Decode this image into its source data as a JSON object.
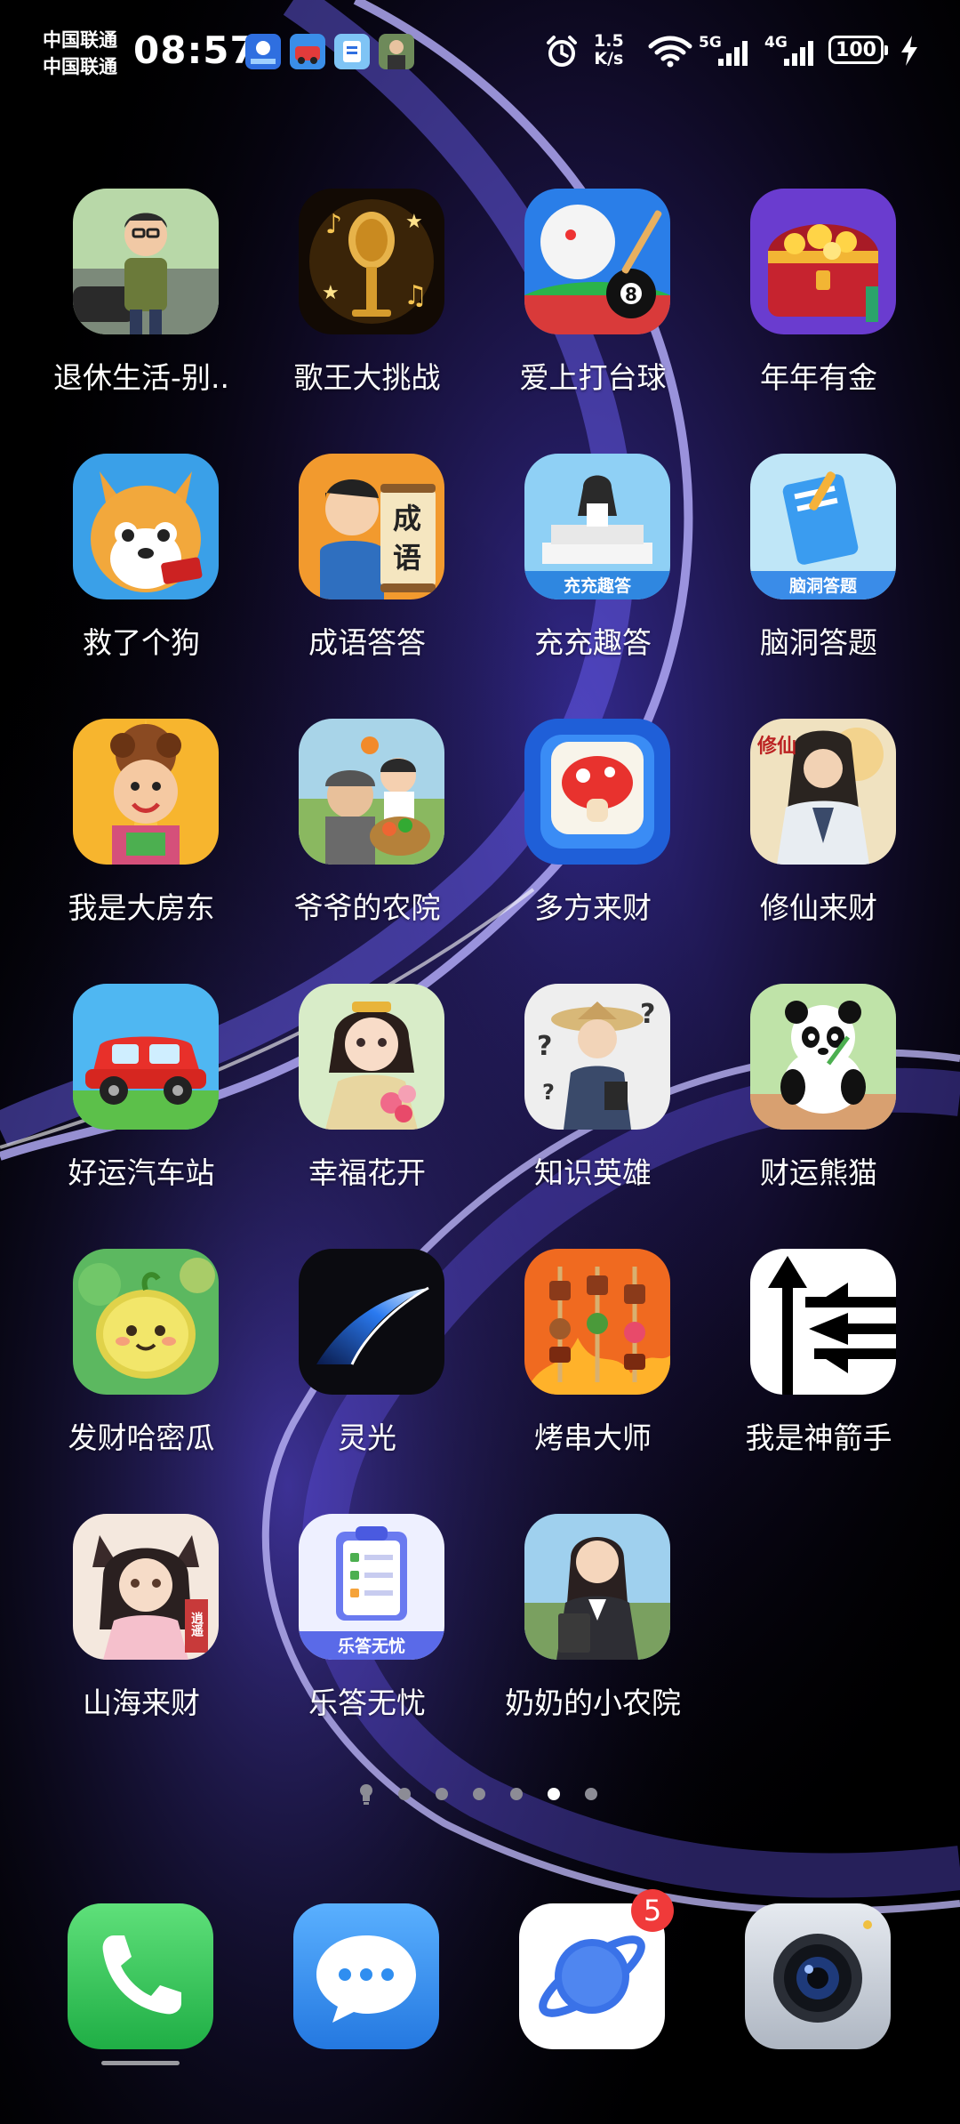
{
  "status_bar": {
    "carrier_1": "中国联通",
    "carrier_2": "中国联通",
    "time": "08:57",
    "net_speed_value": "1.5",
    "net_speed_unit": "K/s",
    "sim1_network": "5G",
    "sim2_network": "4G",
    "battery_level": "100",
    "icons": [
      "alarm-icon",
      "wifi-icon",
      "signal-icon",
      "charging-icon"
    ]
  },
  "apps": [
    {
      "label": "退休生活-别..",
      "icon": "retired-man-icon"
    },
    {
      "label": "歌王大挑战",
      "icon": "microphone-icon"
    },
    {
      "label": "爱上打台球",
      "icon": "billiards-icon"
    },
    {
      "label": "年年有金",
      "icon": "treasure-chest-icon"
    },
    {
      "label": "救了个狗",
      "icon": "dog-icon"
    },
    {
      "label": "成语答答",
      "icon": "idiom-scholar-icon",
      "icon_text": [
        "成",
        "语"
      ]
    },
    {
      "label": "充充趣答",
      "icon": "book-girl-icon",
      "icon_text": "充充趣答"
    },
    {
      "label": "脑洞答题",
      "icon": "blue-book-icon",
      "icon_text": "脑洞答题"
    },
    {
      "label": "我是大房东",
      "icon": "landlady-icon"
    },
    {
      "label": "爷爷的农院",
      "icon": "grandpa-farm-icon"
    },
    {
      "label": "多方来财",
      "icon": "mushroom-tile-icon"
    },
    {
      "label": "修仙来财",
      "icon": "cultivator-icon",
      "icon_text": "修仙"
    },
    {
      "label": "好运汽车站",
      "icon": "red-car-icon"
    },
    {
      "label": "幸福花开",
      "icon": "flower-lady-icon"
    },
    {
      "label": "知识英雄",
      "icon": "scholar-question-icon"
    },
    {
      "label": "财运熊猫",
      "icon": "panda-icon"
    },
    {
      "label": "发财哈密瓜",
      "icon": "melon-icon"
    },
    {
      "label": "灵光",
      "icon": "lingguang-icon"
    },
    {
      "label": "烤串大师",
      "icon": "skewer-icon"
    },
    {
      "label": "我是神箭手",
      "icon": "arrows-icon"
    },
    {
      "label": "山海来财",
      "icon": "fox-girl-icon",
      "icon_text": "逍遥"
    },
    {
      "label": "乐答无忧",
      "icon": "clipboard-icon",
      "icon_text": "乐答无忧"
    },
    {
      "label": "奶奶的小农院",
      "icon": "businesswoman-icon"
    }
  ],
  "page_indicator": {
    "pages": 6,
    "active_page": 5,
    "first_icon": "lightbulb-icon"
  },
  "dock": [
    {
      "name": "phone",
      "icon": "phone-icon"
    },
    {
      "name": "messages",
      "icon": "chat-bubble-icon"
    },
    {
      "name": "browser",
      "icon": "planet-icon",
      "badge": "5"
    },
    {
      "name": "camera",
      "icon": "camera-icon"
    }
  ],
  "colors": {
    "background": "#000000",
    "wallpaper_glow": "#6a5cff",
    "badge": "#f03a3a",
    "phone_green": "#2ecc55",
    "messages_blue": "#2f8ef0"
  }
}
